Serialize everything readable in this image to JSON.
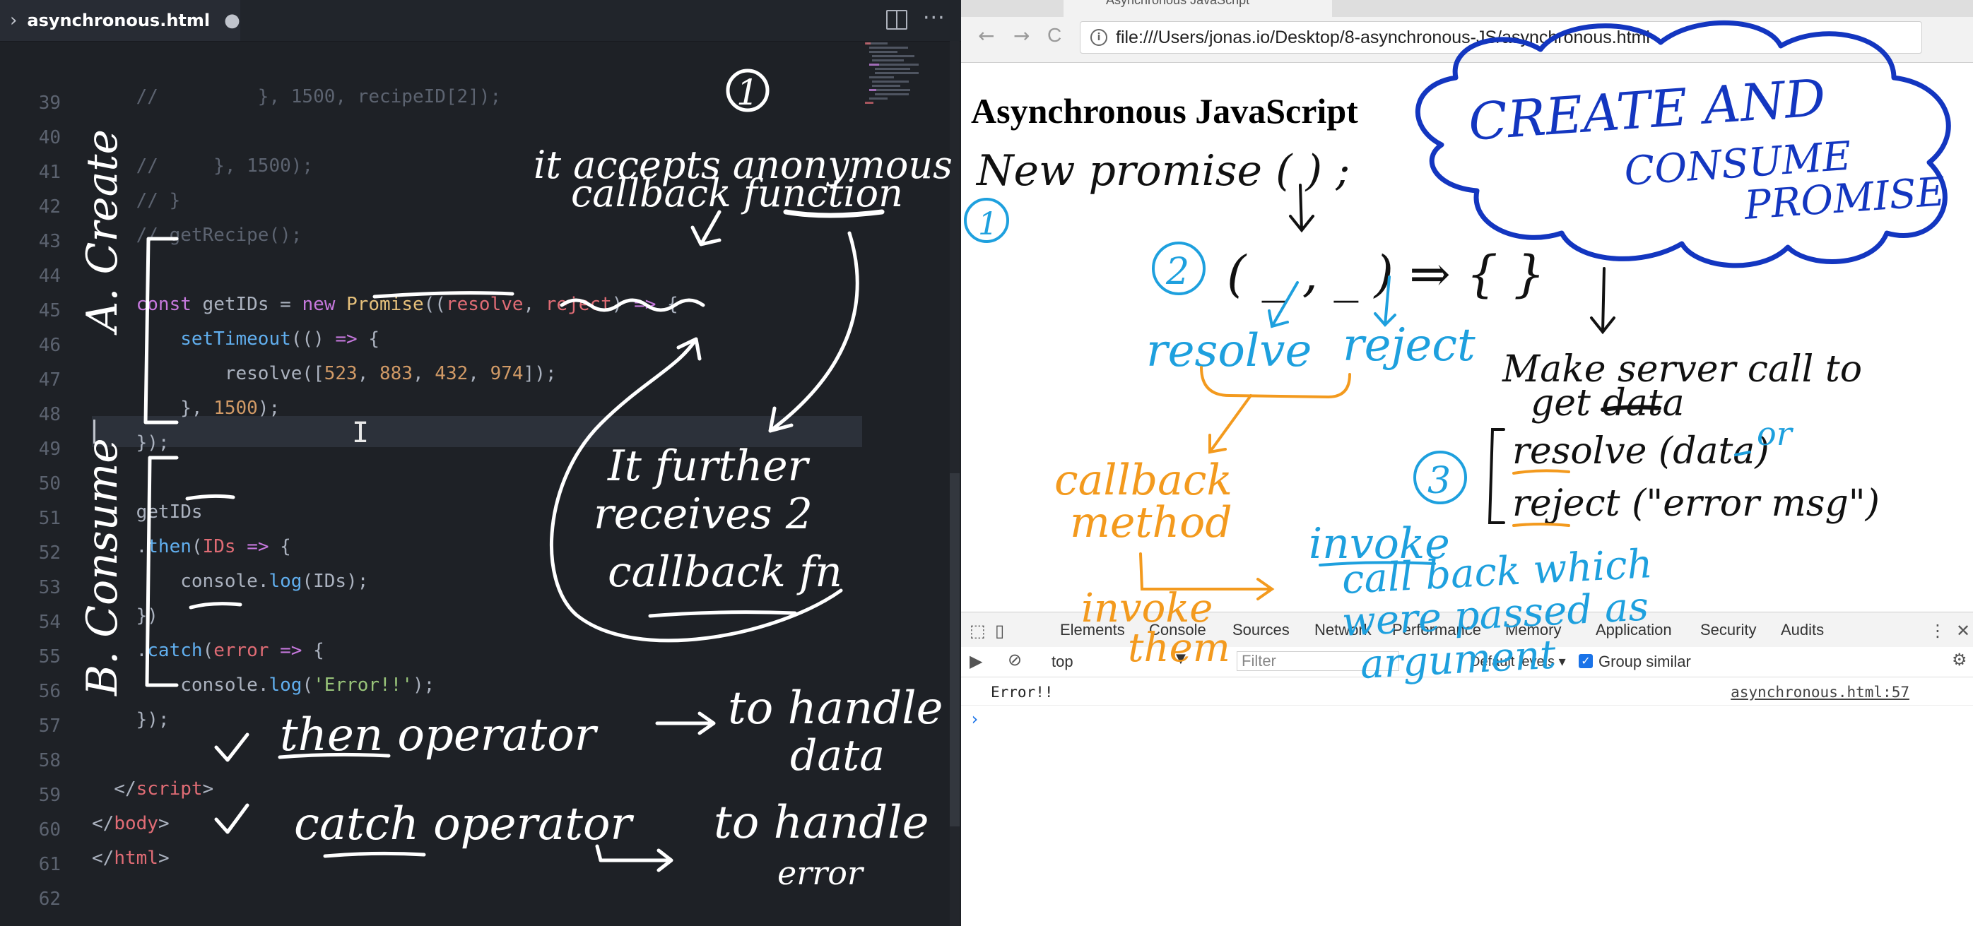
{
  "editor": {
    "tab": {
      "filename": "asynchronous.html",
      "modified_dot": "●"
    },
    "icons": {
      "split": "split-editor-icon",
      "more": "···"
    },
    "lines": [
      {
        "n": "39",
        "tokens": []
      },
      {
        "n": "40",
        "tokens": [
          {
            "t": "    //         }, 1500, recipeID[2]);",
            "c": "com"
          }
        ]
      },
      {
        "n": "41",
        "tokens": []
      },
      {
        "n": "42",
        "tokens": [
          {
            "t": "    //     }, 1500);",
            "c": "com"
          }
        ]
      },
      {
        "n": "43",
        "tokens": [
          {
            "t": "    // }",
            "c": "com"
          }
        ]
      },
      {
        "n": "44",
        "tokens": [
          {
            "t": "    // getRecipe();",
            "c": "com"
          }
        ]
      },
      {
        "n": "45",
        "tokens": []
      },
      {
        "n": "46",
        "tokens": [
          {
            "t": "    const ",
            "c": "kw"
          },
          {
            "t": "getIDs",
            "c": "def"
          },
          {
            "t": " = ",
            "c": "br"
          },
          {
            "t": "new ",
            "c": "kw"
          },
          {
            "t": "Promise",
            "c": "var"
          },
          {
            "t": "((",
            "c": "br"
          },
          {
            "t": "resolve",
            "c": "par"
          },
          {
            "t": ", ",
            "c": "br"
          },
          {
            "t": "reject",
            "c": "par"
          },
          {
            "t": ") ",
            "c": "br"
          },
          {
            "t": "=>",
            "c": "kw"
          },
          {
            "t": " {",
            "c": "br"
          }
        ]
      },
      {
        "n": "47",
        "tokens": [
          {
            "t": "        setTimeout",
            "c": "fn"
          },
          {
            "t": "(() ",
            "c": "br"
          },
          {
            "t": "=>",
            "c": "kw"
          },
          {
            "t": " {",
            "c": "br"
          }
        ]
      },
      {
        "n": "48",
        "tokens": [
          {
            "t": "            resolve",
            "c": "def"
          },
          {
            "t": "([",
            "c": "br"
          },
          {
            "t": "523",
            "c": "num"
          },
          {
            "t": ", ",
            "c": "br"
          },
          {
            "t": "883",
            "c": "num"
          },
          {
            "t": ", ",
            "c": "br"
          },
          {
            "t": "432",
            "c": "num"
          },
          {
            "t": ", ",
            "c": "br"
          },
          {
            "t": "974",
            "c": "num"
          },
          {
            "t": "]);",
            "c": "br"
          }
        ]
      },
      {
        "n": "49",
        "tokens": [
          {
            "t": "        }, ",
            "c": "br"
          },
          {
            "t": "1500",
            "c": "num"
          },
          {
            "t": ");",
            "c": "br"
          }
        ]
      },
      {
        "n": "50",
        "tokens": [
          {
            "t": "    });",
            "c": "br"
          }
        ]
      },
      {
        "n": "51",
        "tokens": []
      },
      {
        "n": "52",
        "tokens": [
          {
            "t": "    getIDs",
            "c": "def"
          }
        ]
      },
      {
        "n": "53",
        "tokens": [
          {
            "t": "    .",
            "c": "br"
          },
          {
            "t": "then",
            "c": "fn"
          },
          {
            "t": "(",
            "c": "br"
          },
          {
            "t": "IDs",
            "c": "par"
          },
          {
            "t": " ",
            "c": "br"
          },
          {
            "t": "=>",
            "c": "kw"
          },
          {
            "t": " {",
            "c": "br"
          }
        ]
      },
      {
        "n": "54",
        "tokens": [
          {
            "t": "        console",
            "c": "def"
          },
          {
            "t": ".",
            "c": "br"
          },
          {
            "t": "log",
            "c": "fn"
          },
          {
            "t": "(IDs);",
            "c": "br"
          }
        ]
      },
      {
        "n": "55",
        "tokens": [
          {
            "t": "    })",
            "c": "br"
          }
        ]
      },
      {
        "n": "56",
        "tokens": [
          {
            "t": "    .",
            "c": "br"
          },
          {
            "t": "catch",
            "c": "fn"
          },
          {
            "t": "(",
            "c": "br"
          },
          {
            "t": "error",
            "c": "par"
          },
          {
            "t": " ",
            "c": "br"
          },
          {
            "t": "=>",
            "c": "kw"
          },
          {
            "t": " {",
            "c": "br"
          }
        ]
      },
      {
        "n": "57",
        "tokens": [
          {
            "t": "        console",
            "c": "def"
          },
          {
            "t": ".",
            "c": "br"
          },
          {
            "t": "log",
            "c": "fn"
          },
          {
            "t": "(",
            "c": "br"
          },
          {
            "t": "'Error!!'",
            "c": "str"
          },
          {
            "t": ");",
            "c": "br"
          }
        ]
      },
      {
        "n": "58",
        "tokens": [
          {
            "t": "    });",
            "c": "br"
          }
        ]
      },
      {
        "n": "59",
        "tokens": []
      },
      {
        "n": "60",
        "tokens": [
          {
            "t": "  </",
            "c": "tagb"
          },
          {
            "t": "script",
            "c": "tag"
          },
          {
            "t": ">",
            "c": "tagb"
          }
        ]
      },
      {
        "n": "61",
        "tokens": [
          {
            "t": "</",
            "c": "tagb"
          },
          {
            "t": "body",
            "c": "tag"
          },
          {
            "t": ">",
            "c": "tagb"
          }
        ]
      },
      {
        "n": "62",
        "tokens": [
          {
            "t": "</",
            "c": "tagb"
          },
          {
            "t": "html",
            "c": "tag"
          },
          {
            "t": ">",
            "c": "tagb"
          }
        ]
      }
    ],
    "colors": {
      "background": "#1e2126",
      "comment": "#5c6370",
      "keyword": "#c678dd",
      "number": "#d19a66",
      "param": "#e06c75",
      "string": "#98c379"
    }
  },
  "browser": {
    "tab_title": "Asynchronous JavaScript",
    "nav": {
      "back": "←",
      "forward": "→",
      "reload": "C"
    },
    "url": "file:///Users/jonas.io/Desktop/8-asynchronous-JS/asynchronous.html",
    "heading": "Asynchronous JavaScript",
    "devtools": {
      "tabs": [
        "Elements",
        "Console",
        "Sources",
        "Network",
        "Performance",
        "Memory",
        "Application",
        "Security",
        "Audits"
      ],
      "context": "top",
      "filter_placeholder": "Filter",
      "levels": "Default levels ▾",
      "group_similar": "Group similar",
      "console_message": "Error!!",
      "console_source": "asynchronous.html:57",
      "prompt": "›"
    }
  },
  "annotations": {
    "white": {
      "section_a": "A. Create",
      "section_b": "B. Consume",
      "circle_one": "1",
      "accepts_line1": "it accepts anonymous",
      "accepts_line2": "callback function",
      "further_line1": "It further",
      "further_line2": "receives 2",
      "further_line3": "callback fn",
      "then_op": "then operator",
      "to_handle_data_1": "to handle",
      "to_handle_data_2": "data",
      "catch_op": "catch operator",
      "to_handle_error_1": "to handle",
      "to_handle_error_2": "error",
      "check": "✓"
    },
    "black": {
      "new_promise": "New promise ( ) ;",
      "params": "( _ , _ ) ⇒ { }",
      "server_call_1": "Make server call to",
      "server_call_2": "get data",
      "resolve_call": "resolve (data)",
      "reject_call": "reject (\"error msg\")"
    },
    "blue": {
      "circle_one": "1",
      "circle_two": "2",
      "circle_three": "3",
      "resolve": "resolve",
      "reject": "reject",
      "or": "or",
      "invoke": "invoke",
      "callback_which_1": "call back which",
      "callback_which_2": "were passed as",
      "callback_which_3": "argument"
    },
    "orange": {
      "callback_method_1": "callback",
      "callback_method_2": "method",
      "invoke_them_1": "invoke",
      "invoke_them_2": "them"
    },
    "navy": {
      "cloud_1": "CREATE AND",
      "cloud_2": "CONSUME",
      "cloud_3": "PROMISE"
    }
  }
}
